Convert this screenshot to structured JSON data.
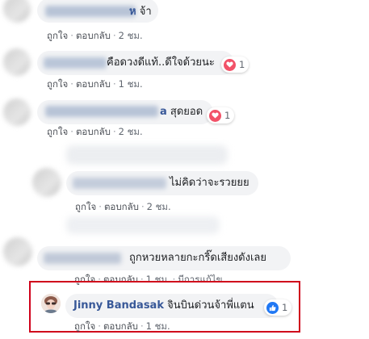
{
  "comments": [
    {
      "text": "จ้า",
      "trail": "ห",
      "like": "ถูกใจ",
      "reply": "ตอบกลับ",
      "time": "2 ชม."
    },
    {
      "text": "คือดวงดีแท้..ดีใจด้วยนะ",
      "like": "ถูกใจ",
      "reply": "ตอบกลับ",
      "time": "1 ชม.",
      "reaction": {
        "icon": "heart-icon",
        "count": "1"
      }
    },
    {
      "name_suffix": "a",
      "text": "สุดยอด",
      "like": "ถูกใจ",
      "reply": "ตอบกลับ",
      "time": "2 ชม.",
      "reaction": {
        "icon": "heart-icon",
        "count": "1"
      }
    },
    {
      "text": "ไม่คิดว่าจะรวยยย",
      "like": "ถูกใจ",
      "reply": "ตอบกลับ",
      "time": "2 ชม."
    },
    {
      "text": "ถูกหวยหลายกะกริ๊ดเสียงดังเลย",
      "like": "ถูกใจ",
      "reply": "ตอบกลับ",
      "time": "1 ชม.",
      "edited": "มีการแก้ไข"
    },
    {
      "name": "Jinny Bandasak",
      "text": "จินบินด่วนจ้าพี่แตน",
      "like": "ถูกใจ",
      "reply": "ตอบกลับ",
      "time": "1 ชม.",
      "reaction": {
        "icon": "like-icon",
        "count": "1"
      }
    }
  ],
  "colors": {
    "name": "#385898",
    "bubble": "#f2f3f5",
    "meta": "#616770",
    "heart": "#f25268",
    "like": "#2078f4",
    "highlight": "#d0021b"
  }
}
